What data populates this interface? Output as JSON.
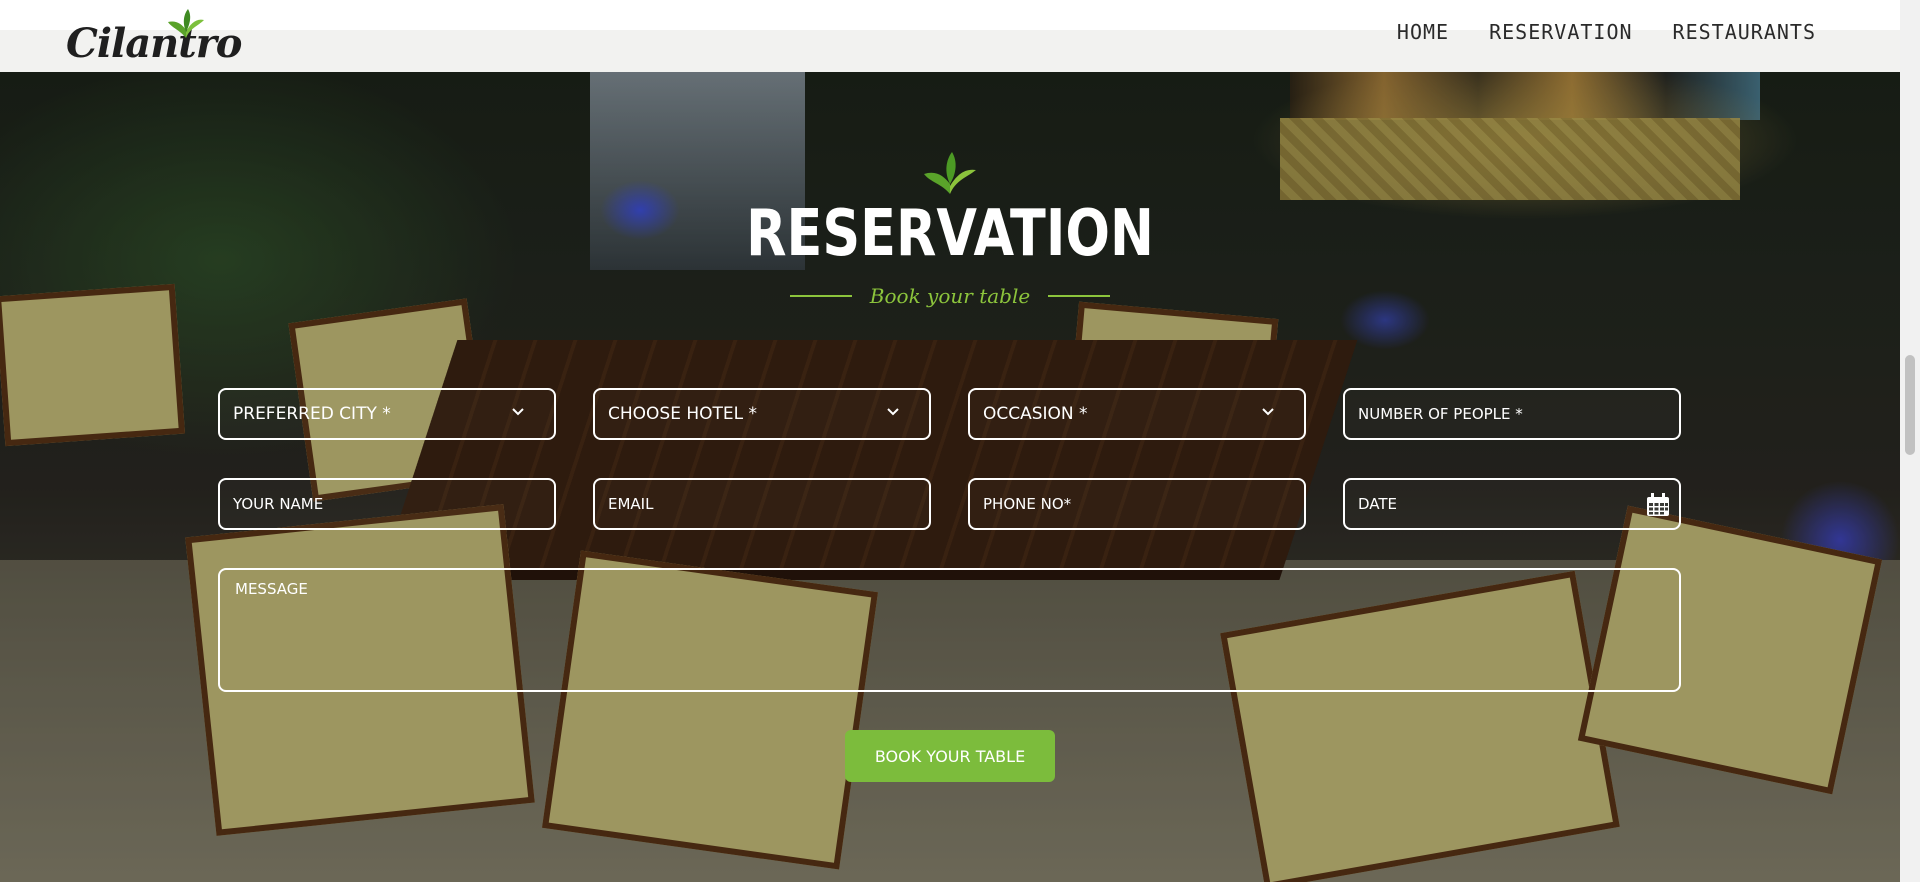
{
  "brand": {
    "logo_text": "Cilantro"
  },
  "nav": {
    "items": [
      {
        "label": "HOME"
      },
      {
        "label": "RESERVATION"
      },
      {
        "label": "RESTAURANTS"
      }
    ]
  },
  "reservation": {
    "title": "RESERVATION",
    "subtitle": "Book your table",
    "fields": {
      "city": "PREFERRED CITY *",
      "hotel": "CHOOSE HOTEL *",
      "occasion": "OCCASION *",
      "people": "NUMBER OF PEOPLE *",
      "name": "YOUR NAME",
      "email": "EMAIL",
      "phone": "PHONE NO*",
      "date": "DATE",
      "message": "MESSAGE"
    },
    "submit_label": "BOOK YOUR TABLE"
  },
  "colors": {
    "accent_green": "#7cbc3c",
    "subtitle_green": "#8cc43c",
    "header_bg": "#f2f2f0"
  },
  "icons": {
    "dropdown": "chevron-down-icon",
    "date": "calendar-icon",
    "brand": "leaf-icon"
  }
}
